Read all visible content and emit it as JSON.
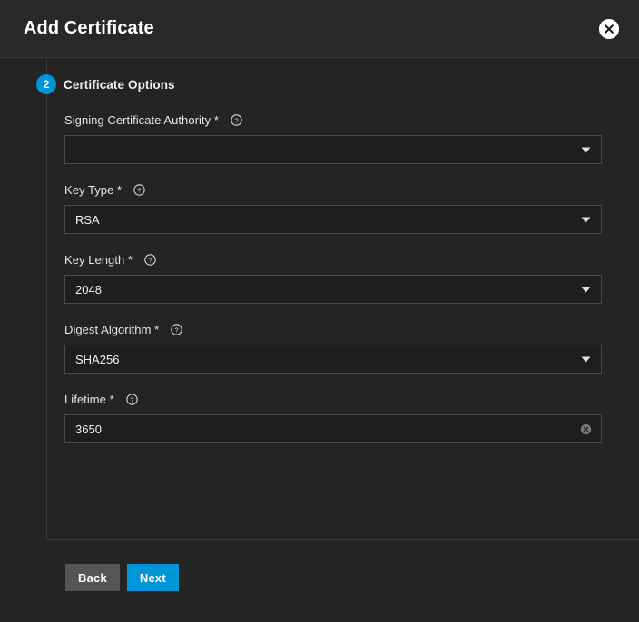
{
  "dialog": {
    "title": "Add Certificate",
    "close_icon": "close-circle-icon"
  },
  "step": {
    "number": "2",
    "label": "Certificate Options"
  },
  "form": {
    "fields": [
      {
        "label": "Signing Certificate Authority",
        "required_marker": "*",
        "help_icon": "help-circle-icon",
        "type": "select",
        "value": "",
        "placeholder": ""
      },
      {
        "label": "Key Type",
        "required_marker": "*",
        "help_icon": "help-circle-icon",
        "type": "select",
        "value": "RSA",
        "placeholder": ""
      },
      {
        "label": "Key Length",
        "required_marker": "*",
        "help_icon": "help-circle-icon",
        "type": "select",
        "value": "2048",
        "placeholder": ""
      },
      {
        "label": "Digest Algorithm",
        "required_marker": "*",
        "help_icon": "help-circle-icon",
        "type": "select",
        "value": "SHA256",
        "placeholder": ""
      },
      {
        "label": "Lifetime",
        "required_marker": "*",
        "help_icon": "help-circle-icon",
        "type": "text",
        "value": "3650",
        "placeholder": "",
        "clear_icon": "clear-circle-icon"
      }
    ]
  },
  "footer": {
    "back_label": "Back",
    "next_label": "Next"
  },
  "colors": {
    "accent": "#0095d9",
    "dialog_bg": "#242424",
    "header_bg": "#282828",
    "field_bg": "#1e1e1e",
    "field_border": "#4a4a4a",
    "back_button": "#555555"
  }
}
